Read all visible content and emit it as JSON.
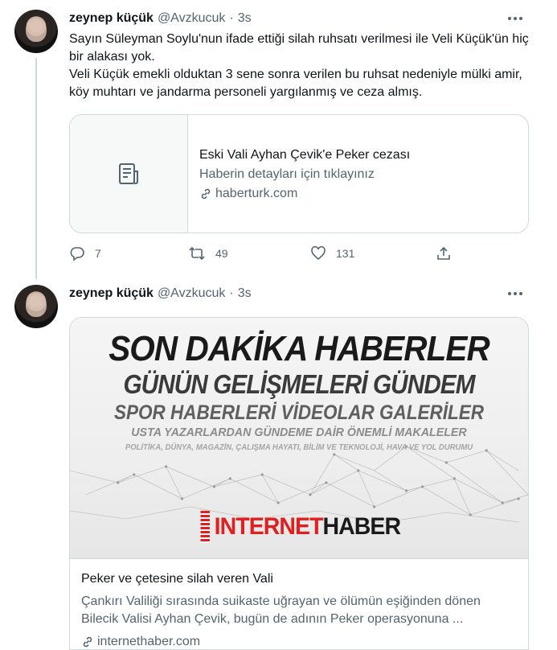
{
  "tweets": [
    {
      "name": "zeynep küçük",
      "handle": "@Avzkucuk",
      "dot": "·",
      "time": "3s",
      "text_lines": [
        "Sayın Süleyman Soylu'nun ifade ettiği silah ruhsatı verilmesi ile Veli Küçük'ün hiç bir alakası yok.",
        "Veli Küçük emekli olduktan 3 sene sonra verilen bu ruhsat nedeniyle mülki amir, köy muhtarı ve jandarma personeli yargılanmış ve ceza almış."
      ],
      "card": {
        "title": "Eski Vali Ayhan Çevik'e Peker cezası",
        "description": "Haberin detayları için tıklayınız",
        "domain": "haberturk.com",
        "icon": "document-icon"
      },
      "actions": {
        "replies": "7",
        "retweets": "49",
        "likes": "131"
      }
    },
    {
      "name": "zeynep küçük",
      "handle": "@Avzkucuk",
      "dot": "·",
      "time": "3s",
      "card": {
        "image_lines": [
          "SON DAKİKA HABERLER",
          "GÜNÜN GELİŞMELERİ GÜNDEM",
          "SPOR HABERLERİ VİDEOLAR GALERİLER",
          "USTA YAZARLARDAN GÜNDEME  DAİR ÖNEMLİ MAKALELER",
          "POLİTİKA, DÜNYA, MAGAZİN, ÇALIŞMA HAYATI, BİLİM VE TEKNOLOJİ, HAVA VE YOL DURUMU"
        ],
        "brand_part1": "INTERNET",
        "brand_part2": "HABER",
        "title": "Peker ve çetesine silah veren Vali",
        "description": "Çankırı Valiliği sırasında suikaste uğrayan ve ölümün eşiğinden dönen Bilecik Valisi Ayhan Çevik, bugün de adının Peker operasyonuna ...",
        "domain": "internethaber.com"
      }
    }
  ],
  "colors": {
    "text_primary": "#0f1419",
    "text_secondary": "#536471",
    "border": "#cfd9de",
    "brand_red": "#e02020"
  }
}
